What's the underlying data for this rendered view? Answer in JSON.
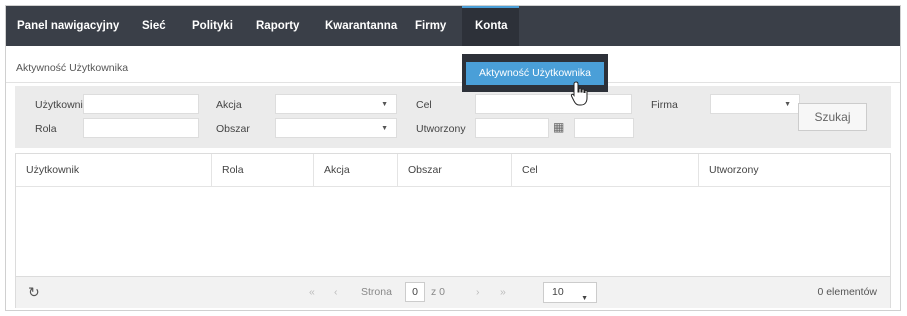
{
  "nav": {
    "items": [
      {
        "label": "Panel nawigacyjny"
      },
      {
        "label": "Sieć"
      },
      {
        "label": "Polityki"
      },
      {
        "label": "Raporty"
      },
      {
        "label": "Kwarantanna"
      },
      {
        "label": "Firmy"
      },
      {
        "label": "Konta",
        "active": true
      }
    ],
    "dropdown": {
      "item": "Aktywność Użytkownika"
    }
  },
  "breadcrumb": "Aktywność Użytkownika",
  "filters": {
    "user_label": "Użytkownik",
    "role_label": "Rola",
    "action_label": "Akcja",
    "area_label": "Obszar",
    "target_label": "Cel",
    "created_label": "Utworzony",
    "company_label": "Firma",
    "search_button": "Szukaj"
  },
  "table": {
    "columns": [
      "Użytkownik",
      "Rola",
      "Akcja",
      "Obszar",
      "Cel",
      "Utworzony"
    ],
    "rows": []
  },
  "pager": {
    "first": "«",
    "prev": "‹",
    "page_label": "Strona",
    "page_value": "0",
    "of_label": "z 0",
    "next": "›",
    "last": "»",
    "page_size": "10",
    "count": "0 elementów"
  },
  "colors": {
    "nav_bg": "#3a3f48",
    "accent": "#4a9fd8",
    "filter_bg": "#ebebeb"
  }
}
